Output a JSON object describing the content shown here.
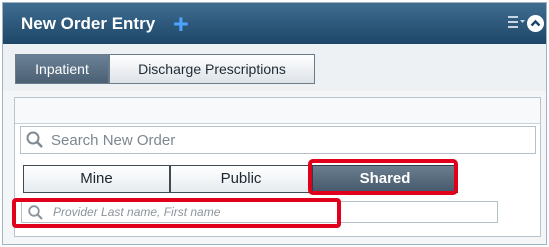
{
  "window": {
    "title": "New Order Entry",
    "add_icon": "plus-icon",
    "menu_icon": "menu-dropdown-icon",
    "collapse_icon": "collapse-chevron-icon"
  },
  "tabs": [
    {
      "label": "Inpatient",
      "active": true
    },
    {
      "label": "Discharge Prescriptions",
      "active": false
    }
  ],
  "search": {
    "placeholder": "Search New Order",
    "icon": "search-icon"
  },
  "filter_tabs": [
    {
      "label": "Mine",
      "active": false
    },
    {
      "label": "Public",
      "active": false
    },
    {
      "label": "Shared",
      "active": true
    }
  ],
  "provider_search": {
    "placeholder": "Provider Last name, First name",
    "icon": "search-icon"
  },
  "colors": {
    "titlebar": "#1d4668",
    "accent_plus": "#4da3ff",
    "highlight": "#e0001b",
    "active_tab": "#4b6073"
  }
}
